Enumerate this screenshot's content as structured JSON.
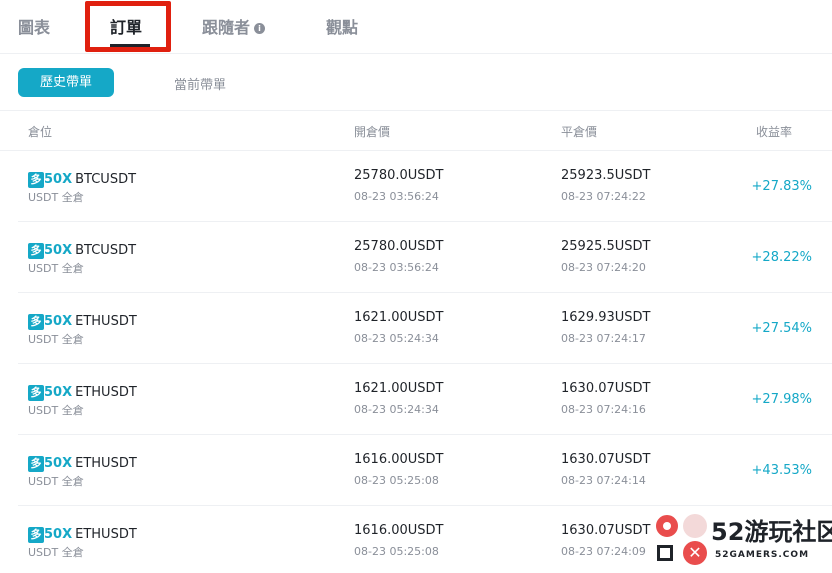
{
  "top_tabs": [
    "圖表",
    "訂單",
    "跟隨者",
    "觀點"
  ],
  "follower_info_icon": "info-icon",
  "sub_tabs": {
    "active": "歷史帶單",
    "inactive": "當前帶單"
  },
  "table_headers": {
    "position": "倉位",
    "open_price": "開倉價",
    "close_price": "平倉價",
    "roi": "收益率"
  },
  "rows": [
    {
      "side": "多",
      "leverage": "50X",
      "symbol": "BTCUSDT",
      "margin": "USDT 全倉",
      "open_price": "25780.0USDT",
      "open_time": "08-23 03:56:24",
      "close_price": "25923.5USDT",
      "close_time": "08-23 07:24:22",
      "roi": "+27.83%"
    },
    {
      "side": "多",
      "leverage": "50X",
      "symbol": "BTCUSDT",
      "margin": "USDT 全倉",
      "open_price": "25780.0USDT",
      "open_time": "08-23 03:56:24",
      "close_price": "25925.5USDT",
      "close_time": "08-23 07:24:20",
      "roi": "+28.22%"
    },
    {
      "side": "多",
      "leverage": "50X",
      "symbol": "ETHUSDT",
      "margin": "USDT 全倉",
      "open_price": "1621.00USDT",
      "open_time": "08-23 05:24:34",
      "close_price": "1629.93USDT",
      "close_time": "08-23 07:24:17",
      "roi": "+27.54%"
    },
    {
      "side": "多",
      "leverage": "50X",
      "symbol": "ETHUSDT",
      "margin": "USDT 全倉",
      "open_price": "1621.00USDT",
      "open_time": "08-23 05:24:34",
      "close_price": "1630.07USDT",
      "close_time": "08-23 07:24:16",
      "roi": "+27.98%"
    },
    {
      "side": "多",
      "leverage": "50X",
      "symbol": "ETHUSDT",
      "margin": "USDT 全倉",
      "open_price": "1616.00USDT",
      "open_time": "08-23 05:25:08",
      "close_price": "1630.07USDT",
      "close_time": "08-23 07:24:14",
      "roi": "+43.53%"
    },
    {
      "side": "多",
      "leverage": "50X",
      "symbol": "ETHUSDT",
      "margin": "USDT 全倉",
      "open_price": "1616.00USDT",
      "open_time": "08-23 05:25:08",
      "close_price": "1630.07USDT",
      "close_time": "08-23 07:24:09",
      "roi": ""
    }
  ],
  "watermark": {
    "name": "52游玩社区",
    "url": "52GAMERS.COM"
  },
  "colors": {
    "accent": "#15a8c7",
    "highlight": "#e0200f",
    "muted": "#8a8f99"
  }
}
